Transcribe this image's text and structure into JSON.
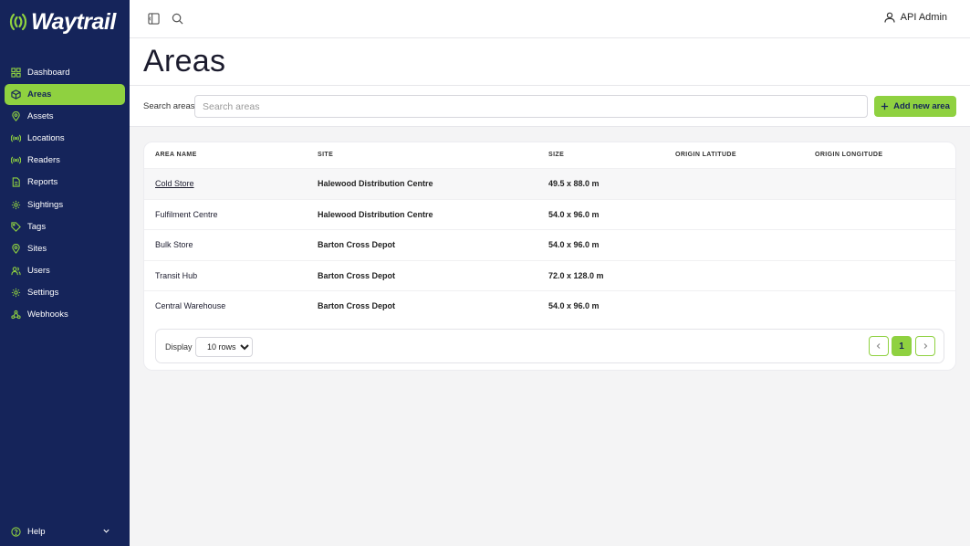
{
  "app": {
    "logo_text": "Waytrail"
  },
  "sidebar": {
    "items": [
      {
        "label": "Dashboard",
        "icon": "grid-icon",
        "active": false
      },
      {
        "label": "Areas",
        "icon": "area-icon",
        "active": true
      },
      {
        "label": "Assets",
        "icon": "pin-icon",
        "active": false
      },
      {
        "label": "Locations",
        "icon": "signal-icon",
        "active": false
      },
      {
        "label": "Readers",
        "icon": "signal-icon",
        "active": false
      },
      {
        "label": "Reports",
        "icon": "report-icon",
        "active": false
      },
      {
        "label": "Sightings",
        "icon": "gear-icon",
        "active": false
      },
      {
        "label": "Tags",
        "icon": "tag-icon",
        "active": false
      },
      {
        "label": "Sites",
        "icon": "pin-icon",
        "active": false
      },
      {
        "label": "Users",
        "icon": "users-icon",
        "active": false
      },
      {
        "label": "Settings",
        "icon": "gear-icon",
        "active": false
      },
      {
        "label": "Webhooks",
        "icon": "webhook-icon",
        "active": false
      }
    ],
    "help_label": "Help"
  },
  "topbar": {
    "user_name": "API Admin"
  },
  "page": {
    "title": "Areas"
  },
  "search": {
    "label": "Search areas",
    "placeholder": "Search areas",
    "value": ""
  },
  "actions": {
    "add_label": "Add new area"
  },
  "table": {
    "columns": [
      "AREA NAME",
      "SITE",
      "SIZE",
      "ORIGIN LATITUDE",
      "ORIGIN LONGITUDE"
    ],
    "rows": [
      {
        "name": "Cold Store",
        "site": "Halewood Distribution Centre",
        "size": "49.5 x 88.0 m",
        "lat": "",
        "lon": ""
      },
      {
        "name": "Fulfilment Centre",
        "site": "Halewood Distribution Centre",
        "size": "54.0 x 96.0 m",
        "lat": "",
        "lon": ""
      },
      {
        "name": "Bulk Store",
        "site": "Barton Cross Depot",
        "size": "54.0 x 96.0 m",
        "lat": "",
        "lon": ""
      },
      {
        "name": "Transit Hub",
        "site": "Barton Cross Depot",
        "size": "72.0 x 128.0 m",
        "lat": "",
        "lon": ""
      },
      {
        "name": "Central Warehouse",
        "site": "Barton Cross Depot",
        "size": "54.0 x 96.0 m",
        "lat": "",
        "lon": ""
      }
    ]
  },
  "pagination": {
    "display_label": "Display",
    "rows_option": "10 rows",
    "current_page": "1"
  },
  "colors": {
    "sidebar": "#15245a",
    "accent": "#8fd140"
  }
}
